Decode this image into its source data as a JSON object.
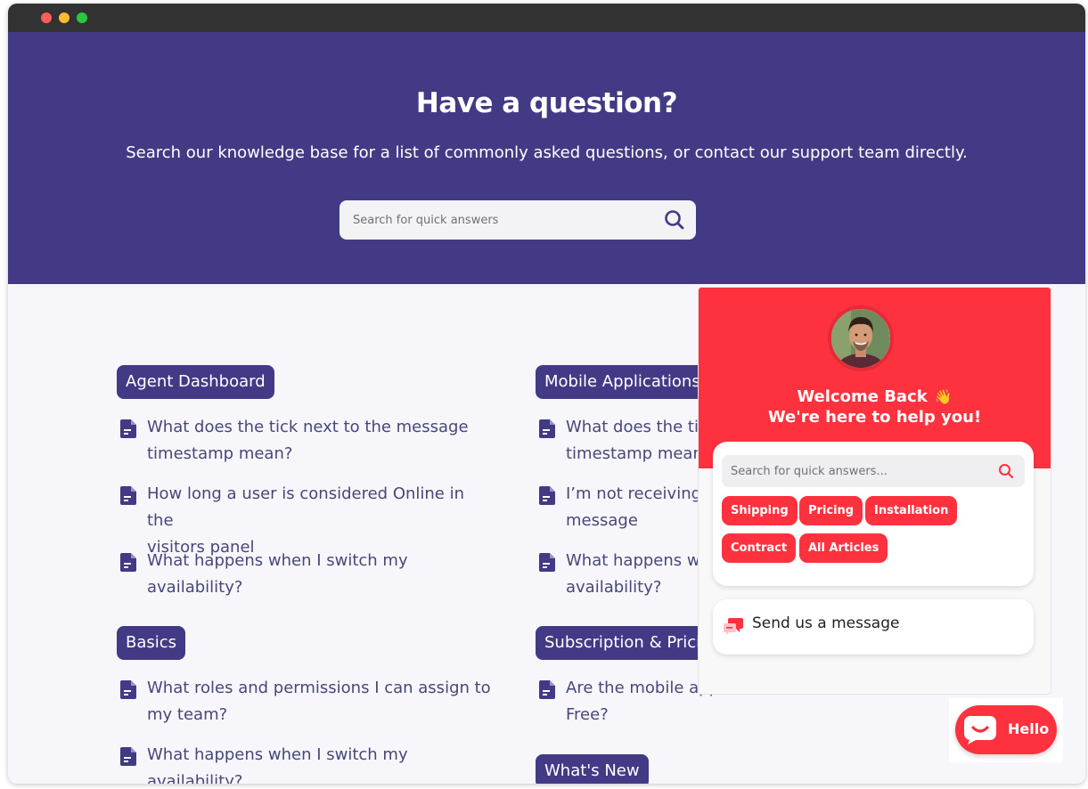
{
  "window": {
    "controls": [
      "close",
      "minimize",
      "maximize"
    ]
  },
  "hero": {
    "title": "Have a question?",
    "subtitle": "Search our knowledge base for a list of commonly asked questions, or contact our support team directly.",
    "search_placeholder": "Search for quick answers"
  },
  "categories": {
    "agent_dashboard": {
      "label": "Agent Dashboard",
      "articles": [
        {
          "line1": "What does the tick next to the message",
          "line2": "timestamp mean?"
        },
        {
          "line1": "How long a user is considered Online in the",
          "line2": "visitors panel"
        },
        {
          "line1": "What happens when I switch my",
          "line2": "availability?"
        }
      ]
    },
    "basics": {
      "label": "Basics",
      "articles": [
        {
          "line1": "What roles and permissions I can assign to",
          "line2": "my team?"
        },
        {
          "line1": "What happens when I switch my",
          "line2": "availability?"
        }
      ]
    },
    "mobile_applications": {
      "label": "Mobile Applications",
      "articles": [
        {
          "line1": "What does the tick next to the message",
          "line2": "timestamp mean?"
        },
        {
          "line1": "I’m not receiving notifications for a new",
          "line2": "message"
        },
        {
          "line1": "What happens when I switch my",
          "line2": "availability?"
        }
      ]
    },
    "subscription_pricing": {
      "label": "Subscription & Pricing",
      "articles": [
        {
          "line1": "Are the mobile apps available on the",
          "line2": "Free?"
        }
      ]
    },
    "whats_new": {
      "label": "What's New"
    }
  },
  "widget": {
    "welcome_line1": "Welcome Back",
    "wave_emoji": "👋",
    "welcome_line2": "We're here to help you!",
    "search_placeholder": "Search for quick answers...",
    "tags": [
      "Shipping",
      "Pricing",
      "Installation",
      "Contract",
      "All Articles"
    ],
    "send_message_label": "Send us a message",
    "brand_color": "#fe313f"
  },
  "launcher": {
    "label": "Hello"
  },
  "colors": {
    "hero_bg": "#433a86",
    "pill_bg": "#433a86",
    "article_text": "#47477a"
  }
}
